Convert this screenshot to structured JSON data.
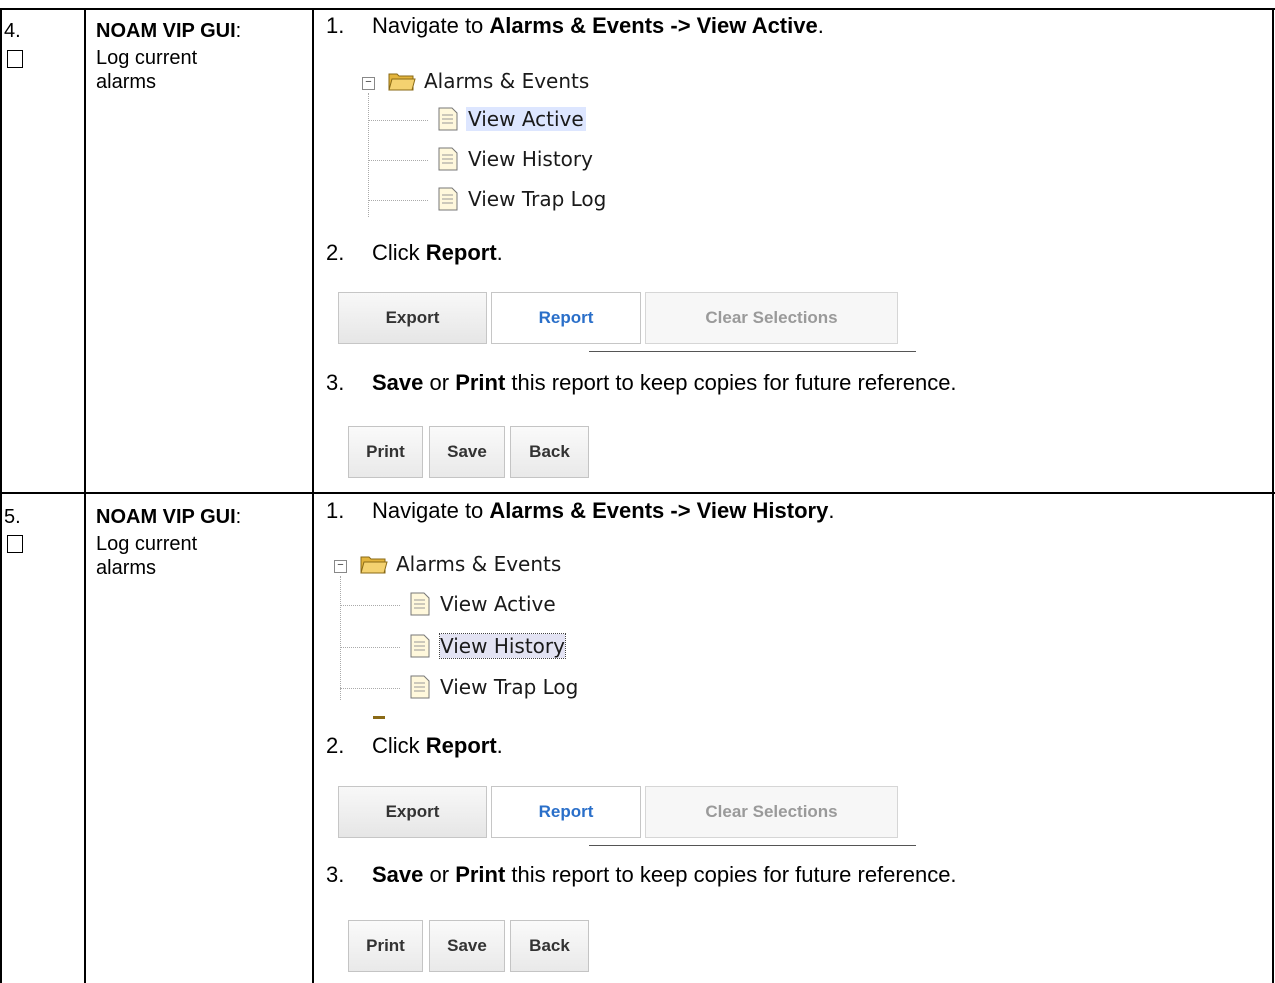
{
  "rows": [
    {
      "step": "4.",
      "title": "NOAM VIP GUI",
      "title_suffix": ":",
      "subtitle": "Log current alarms",
      "step1": {
        "num": "1.",
        "prefix": "Navigate to ",
        "bold": "Alarms & Events -> View Active",
        "suffix": "."
      },
      "tree": {
        "root": "Alarms & Events",
        "items": [
          "View Active",
          "View History",
          "View Trap Log"
        ],
        "selected": "View Active"
      },
      "step2": {
        "num": "2.",
        "prefix": "Click ",
        "bold": "Report",
        "suffix": "."
      },
      "buttons": [
        "Export",
        "Report",
        "Clear Selections"
      ],
      "step3": {
        "num": "3.",
        "bold1": "Save",
        "mid": " or ",
        "bold2": "Print",
        "suffix": " this report to keep copies for future reference."
      },
      "actions": [
        "Print",
        "Save",
        "Back"
      ]
    },
    {
      "step": "5.",
      "title": "NOAM VIP GUI",
      "title_suffix": ":",
      "subtitle": "Log current alarms",
      "step1": {
        "num": "1.",
        "prefix": "Navigate to ",
        "bold": "Alarms & Events -> View History",
        "suffix": "."
      },
      "tree": {
        "root": "Alarms & Events",
        "items": [
          "View Active",
          "View History",
          "View Trap Log"
        ],
        "selected": "View History"
      },
      "step2": {
        "num": "2.",
        "prefix": "Click ",
        "bold": "Report",
        "suffix": "."
      },
      "buttons": [
        "Export",
        "Report",
        "Clear Selections"
      ],
      "step3": {
        "num": "3.",
        "bold1": "Save",
        "mid": " or ",
        "bold2": "Print",
        "suffix": " this report to keep copies for future reference."
      },
      "actions": [
        "Print",
        "Save",
        "Back"
      ]
    }
  ]
}
